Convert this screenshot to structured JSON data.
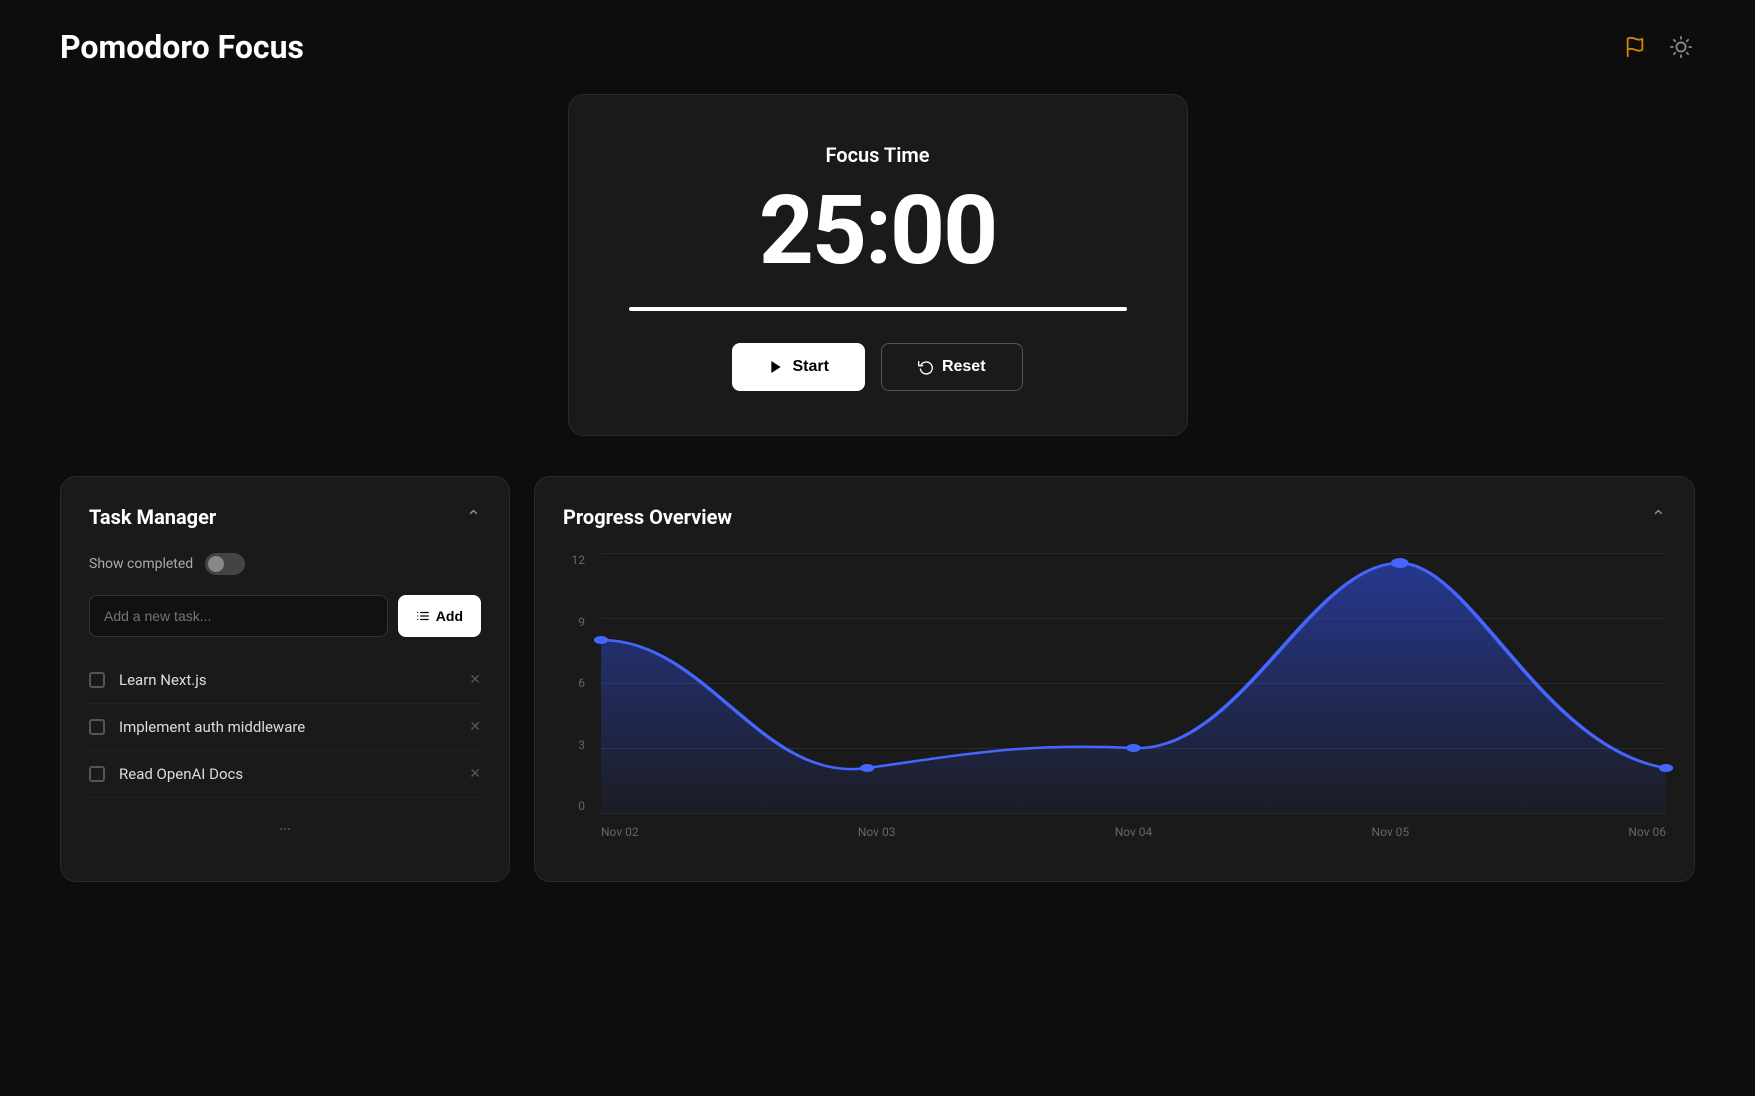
{
  "app": {
    "title": "Pomodoro Focus"
  },
  "header": {
    "flag_icon": "🚩",
    "settings_icon": "☀"
  },
  "timer": {
    "label": "Focus Time",
    "display": "25:00",
    "progress": 100,
    "start_label": "Start",
    "reset_label": "Reset"
  },
  "task_manager": {
    "title": "Task Manager",
    "show_completed_label": "Show completed",
    "toggle_state": false,
    "add_placeholder": "Add a new task...",
    "add_button_label": "Add",
    "tasks": [
      {
        "id": 1,
        "text": "Learn Next.js",
        "completed": false
      },
      {
        "id": 2,
        "text": "Implement auth middleware",
        "completed": false
      },
      {
        "id": 3,
        "text": "Read OpenAI Docs",
        "completed": false
      }
    ]
  },
  "progress_overview": {
    "title": "Progress Overview",
    "y_labels": [
      "12",
      "9",
      "6",
      "3",
      "0"
    ],
    "x_labels": [
      "Nov 02",
      "Nov 03",
      "Nov 04",
      "Nov 05",
      "Nov 06"
    ],
    "data_points": [
      {
        "x": 0,
        "y": 8
      },
      {
        "x": 0.25,
        "y": 1
      },
      {
        "x": 0.5,
        "y": 2
      },
      {
        "x": 0.75,
        "y": 10.5
      },
      {
        "x": 1,
        "y": 2.5
      }
    ],
    "y_max": 12
  }
}
